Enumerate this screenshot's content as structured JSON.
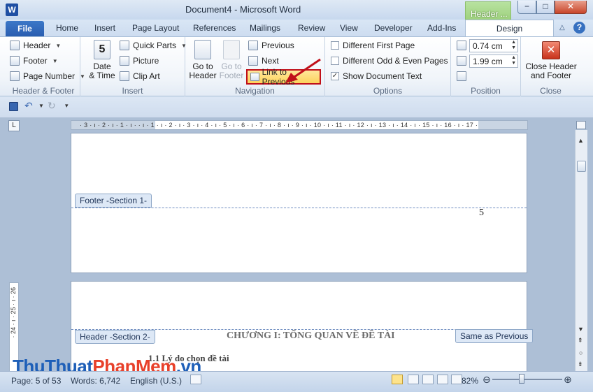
{
  "window": {
    "title": "Document4  -  Microsoft Word",
    "app_icon": "W",
    "context_tab_title": "Header ...",
    "controls": {
      "minimize": "−",
      "maximize": "□",
      "close": "✕"
    }
  },
  "tabs": {
    "file": "File",
    "items": [
      "Home",
      "Insert",
      "Page Layout",
      "References",
      "Mailings",
      "Review",
      "View",
      "Developer",
      "Add-Ins"
    ],
    "active": "Design",
    "help": "?"
  },
  "ribbon": {
    "header_footer": {
      "label": "Header & Footer",
      "header": "Header",
      "footer": "Footer",
      "page_number": "Page Number"
    },
    "insert": {
      "label": "Insert",
      "date_time_line1": "Date",
      "date_time_line2": "& Time",
      "quick_parts": "Quick Parts",
      "picture": "Picture",
      "clip_art": "Clip Art"
    },
    "navigation": {
      "label": "Navigation",
      "goto_header_line1": "Go to",
      "goto_header_line2": "Header",
      "goto_footer_line1": "Go to",
      "goto_footer_line2": "Footer",
      "previous": "Previous",
      "next": "Next",
      "link_to_previous": "Link to Previous"
    },
    "options": {
      "label": "Options",
      "different_first_page": "Different First Page",
      "different_odd_even": "Different Odd & Even Pages",
      "show_document_text": "Show Document Text",
      "show_document_text_checked": true
    },
    "position": {
      "label": "Position",
      "header_from_top": "0.74 cm",
      "footer_from_bottom": "1.99 cm"
    },
    "close": {
      "label": "Close",
      "button_line1": "Close Header",
      "button_line2": "and Footer"
    }
  },
  "ruler": {
    "horizontal": "· 3 · ı · 2 · ı · 1 · ı ·   · ı · 1 · ı · 2 · ı · 3 · ı · 4 · ı · 5 · ı · 6 · ı · 7 · ı · 8 · ı · 9 · ı · 10 · ı · 11 · ı · 12 · ı · 13 · ı · 14 · ı · 15 · ı · 16 · ı · 17 ·",
    "vertical": "· 24 · ı · 25 · ı · 26"
  },
  "document": {
    "footer_label": "Footer -Section 1-",
    "page_number": "5",
    "header_label": "Header -Section 2-",
    "same_as_previous": "Same as Previous",
    "chapter_heading": "CHƯƠNG I: TỔNG QUAN VỀ ĐỀ TÀI",
    "section_heading": "1.1 Lý do chọn đề tài"
  },
  "statusbar": {
    "page": "Page: 5 of 53",
    "words": "Words: 6,742",
    "language": "English (U.S.)",
    "zoom": "82%",
    "zoom_level_percent": 82
  },
  "watermark": {
    "part1": "ThuThuat",
    "part2": "PhanMem",
    "part3": ".vn"
  },
  "colors": {
    "accent": "#2a5db0",
    "context_tab": "#9fd17e",
    "highlight_border": "#c0101a"
  }
}
